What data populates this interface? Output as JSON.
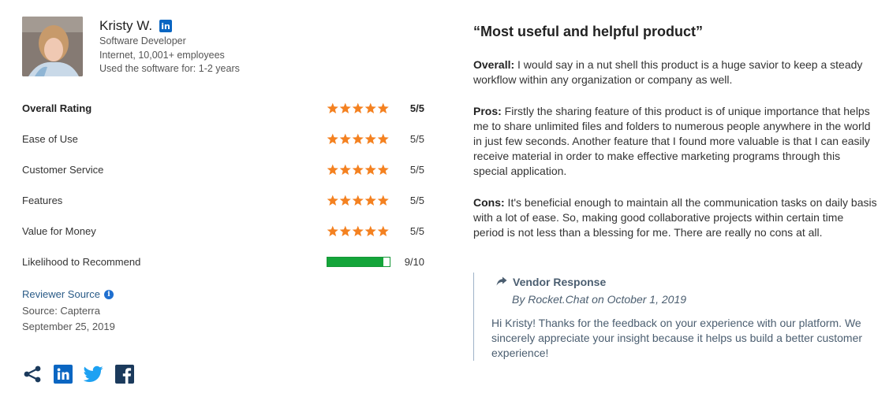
{
  "reviewer": {
    "name": "Kristy W.",
    "title": "Software Developer",
    "company": "Internet, 10,001+ employees",
    "usage": "Used the software for: 1-2 years"
  },
  "ratings": [
    {
      "label": "Overall Rating",
      "stars": 5,
      "value": "5/5",
      "bold": true
    },
    {
      "label": "Ease of Use",
      "stars": 5,
      "value": "5/5"
    },
    {
      "label": "Customer Service",
      "stars": 5,
      "value": "5/5"
    },
    {
      "label": "Features",
      "stars": 5,
      "value": "5/5"
    },
    {
      "label": "Value for Money",
      "stars": 5,
      "value": "5/5"
    }
  ],
  "likelihood": {
    "label": "Likelihood to Recommend",
    "value": "9/10",
    "fraction": 0.9
  },
  "source": {
    "heading": "Reviewer Source",
    "source": "Source: Capterra",
    "date": "September 25, 2019"
  },
  "share_icons": [
    "share-icon",
    "linkedin-icon",
    "twitter-icon",
    "facebook-icon"
  ],
  "review": {
    "title": "“Most useful and helpful product”",
    "overall_label": "Overall:",
    "overall": " I would say in a nut shell this product is a huge savior to keep a steady workflow within any organization or company as well.",
    "pros_label": "Pros:",
    "pros": " Firstly the sharing feature of this product is of unique importance that helps me to share unlimited files and folders to numerous people anywhere in the world in just few seconds. Another feature that I found more valuable is that I can easily receive material in order to make effective marketing programs through this special application.",
    "cons_label": "Cons:",
    "cons": " It's beneficial enough to maintain all the communication tasks on daily basis with a lot of ease. So, making good collaborative projects within certain time period is not less than a blessing for me. There are really no cons at all."
  },
  "vendor": {
    "heading": "Vendor Response",
    "by": "By Rocket.Chat on October 1, 2019",
    "text": "Hi Kristy! Thanks for the feedback on your experience with our platform. We sincerely appreciate your insight because it helps us build a better customer experience!"
  },
  "colors": {
    "star": "#f48120",
    "bar": "#14a53a",
    "link": "#2a5b87",
    "linkedin": "#0a66c2",
    "twitter": "#1da1f2",
    "share": "#1b3a5c"
  }
}
